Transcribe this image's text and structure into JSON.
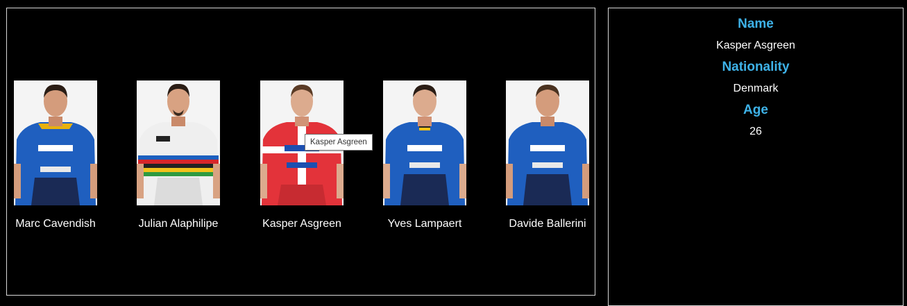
{
  "riders": [
    {
      "name": "Marc Cavendish",
      "jersey": "blue"
    },
    {
      "name": "Julian Alaphilipe",
      "jersey": "world-champion"
    },
    {
      "name": "Kasper Asgreen",
      "jersey": "danish-champion"
    },
    {
      "name": "Yves Lampaert",
      "jersey": "blue"
    },
    {
      "name": "Davide Ballerini",
      "jersey": "blue"
    }
  ],
  "tooltip": "Kasper Asgreen",
  "details": {
    "name_label": "Name",
    "name_value": "Kasper Asgreen",
    "nationality_label": "Nationality",
    "nationality_value": "Denmark",
    "age_label": "Age",
    "age_value": "26"
  },
  "colors": {
    "label_accent": "#3eb2e8",
    "background": "#000000",
    "panel_border": "#d8d8d8"
  }
}
